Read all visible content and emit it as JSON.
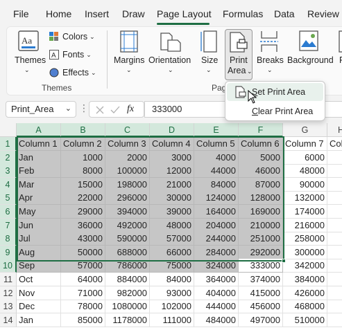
{
  "menu": {
    "tabs": [
      "File",
      "Home",
      "Insert",
      "Draw",
      "Page Layout",
      "Formulas",
      "Data",
      "Review"
    ],
    "active_tab": "Page Layout"
  },
  "ribbon": {
    "themes_group": {
      "themes_label": "Themes",
      "colors_label": "Colors",
      "fonts_label": "Fonts",
      "effects_label": "Effects",
      "group_label": "Themes"
    },
    "page_setup": {
      "margins_label": "Margins",
      "orientation_label": "Orientation",
      "size_label": "Size",
      "print_area_line1": "Print",
      "print_area_line2": "Area",
      "breaks_label": "Breaks",
      "background_label": "Background",
      "print_titles_partial": "P",
      "group_label_partial": "Pag"
    },
    "print_area_menu": {
      "set_label": "Set Print Area",
      "clear_label": "Clear Print Area"
    }
  },
  "formula_bar": {
    "name_box": "Print_Area",
    "fx": "fx",
    "value": "333000"
  },
  "sheet": {
    "columns": [
      "A",
      "B",
      "C",
      "D",
      "E",
      "F",
      "G",
      "H"
    ],
    "row_numbers": [
      "1",
      "2",
      "3",
      "4",
      "5",
      "6",
      "7",
      "8",
      "9",
      "10",
      "11",
      "12",
      "13",
      "14"
    ],
    "rows": [
      [
        "Column 1",
        "Column 2",
        "Column 3",
        "Column 4",
        "Column 5",
        "Column 6",
        "Column 7",
        "Col"
      ],
      [
        "Jan",
        "1000",
        "2000",
        "3000",
        "4000",
        "5000",
        "6000",
        ""
      ],
      [
        "Feb",
        "8000",
        "100000",
        "12000",
        "44000",
        "46000",
        "48000",
        ""
      ],
      [
        "Mar",
        "15000",
        "198000",
        "21000",
        "84000",
        "87000",
        "90000",
        ""
      ],
      [
        "Apr",
        "22000",
        "296000",
        "30000",
        "124000",
        "128000",
        "132000",
        ""
      ],
      [
        "May",
        "29000",
        "394000",
        "39000",
        "164000",
        "169000",
        "174000",
        ""
      ],
      [
        "Jun",
        "36000",
        "492000",
        "48000",
        "204000",
        "210000",
        "216000",
        ""
      ],
      [
        "Jul",
        "43000",
        "590000",
        "57000",
        "244000",
        "251000",
        "258000",
        ""
      ],
      [
        "Aug",
        "50000",
        "688000",
        "66000",
        "284000",
        "292000",
        "300000",
        ""
      ],
      [
        "Sep",
        "57000",
        "786000",
        "75000",
        "324000",
        "333000",
        "342000",
        ""
      ],
      [
        "Oct",
        "64000",
        "884000",
        "84000",
        "364000",
        "374000",
        "384000",
        ""
      ],
      [
        "Nov",
        "71000",
        "982000",
        "93000",
        "404000",
        "415000",
        "426000",
        ""
      ],
      [
        "Dec",
        "78000",
        "1080000",
        "102000",
        "444000",
        "456000",
        "468000",
        ""
      ],
      [
        "Jan",
        "85000",
        "1178000",
        "111000",
        "484000",
        "497000",
        "510000",
        ""
      ]
    ]
  },
  "colors": {
    "accent": "#1e6e43",
    "selection_fill": "#c6c6c6",
    "header_selected": "#d3e8dc"
  }
}
